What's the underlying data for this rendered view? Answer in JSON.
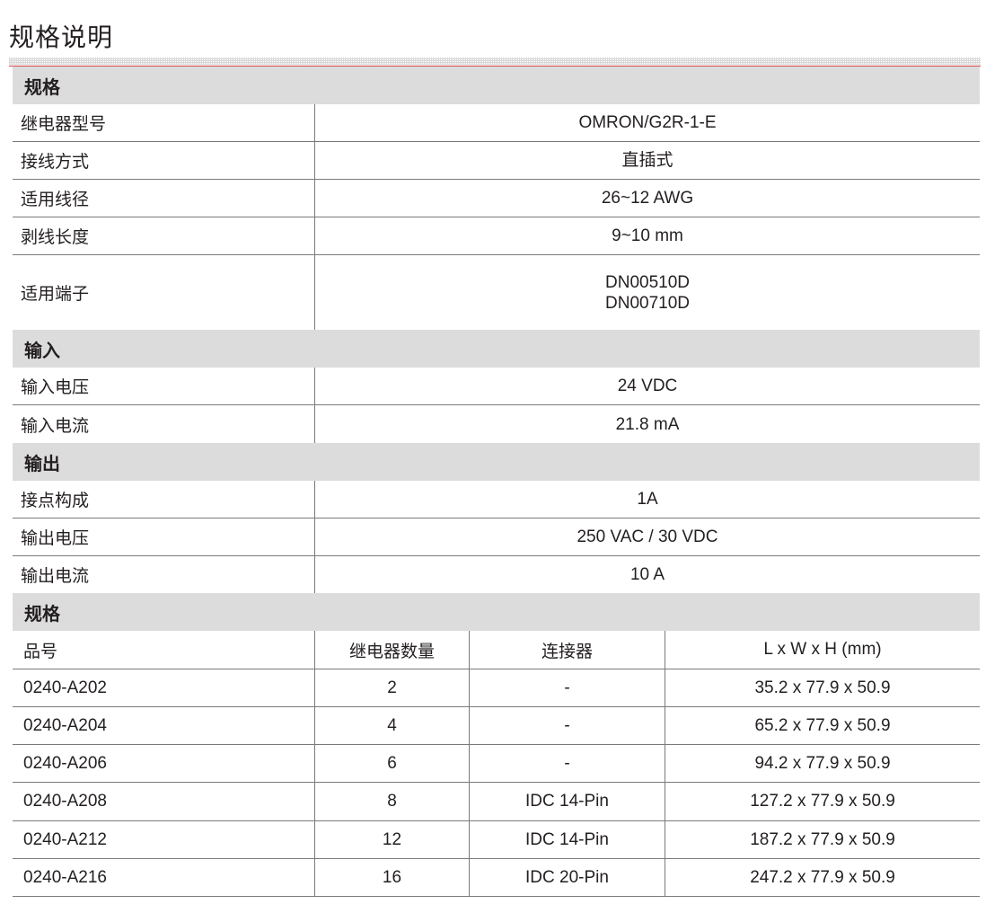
{
  "page_title": "规格说明",
  "sections": {
    "spec": {
      "title": "规格",
      "rows": [
        {
          "label": "继电器型号",
          "value": "OMRON/G2R-1-E"
        },
        {
          "label": "接线方式",
          "value": "直插式"
        },
        {
          "label": "适用线径",
          "value": "26~12 AWG"
        },
        {
          "label": "剥线长度",
          "value": "9~10 mm"
        },
        {
          "label": "适用端子",
          "value": "DN00510D",
          "value2": "DN00710D"
        }
      ]
    },
    "input": {
      "title": "输入",
      "rows": [
        {
          "label": "输入电压",
          "value": "24 VDC"
        },
        {
          "label": "输入电流",
          "value": "21.8 mA"
        }
      ]
    },
    "output": {
      "title": "输出",
      "rows": [
        {
          "label": "接点构成",
          "value": "1A"
        },
        {
          "label": "输出电压",
          "value": "250 VAC / 30 VDC"
        },
        {
          "label": "输出电流",
          "value": "10 A"
        }
      ]
    },
    "models": {
      "title": "规格",
      "headers": [
        "品号",
        "继电器数量",
        "连接器",
        "L x W x H (mm)"
      ],
      "rows": [
        [
          "0240-A202",
          "2",
          "-",
          "35.2 x 77.9 x 50.9"
        ],
        [
          "0240-A204",
          "4",
          "-",
          "65.2 x 77.9 x 50.9"
        ],
        [
          "0240-A206",
          "6",
          "-",
          "94.2 x 77.9 x 50.9"
        ],
        [
          "0240-A208",
          "8",
          "IDC 14-Pin",
          "127.2 x 77.9 x 50.9"
        ],
        [
          "0240-A212",
          "12",
          "IDC 14-Pin",
          "187.2 x 77.9 x 50.9"
        ],
        [
          "0240-A216",
          "16",
          "IDC 20-Pin",
          "247.2 x 77.9 x 50.9"
        ]
      ]
    }
  }
}
